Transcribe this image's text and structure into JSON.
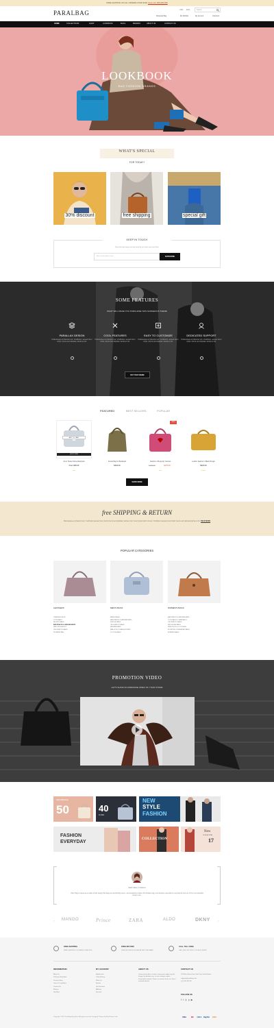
{
  "topbar": {
    "text": "FREE SHIPPING ON ALL ORDERS OVER $100",
    "link": "CALL US: 555-555-555"
  },
  "header": {
    "logo": "PARALBAG",
    "currency": "USD",
    "lang": "ENG",
    "search_placeholder": "Search",
    "account_links": [
      "Shopping Bag",
      "My Wishlist",
      "My account",
      "Checkout"
    ]
  },
  "nav": {
    "items": [
      "HOME",
      "COLLECTIONS",
      "SHOP",
      "LOOKBOOK",
      "BLOG",
      "BRANDS",
      "ABOUT US",
      "CONTACT US"
    ]
  },
  "hero": {
    "title": "LOOKBOOK",
    "subtitle": "BAG FASHION BRANDS"
  },
  "whats_special": {
    "title": "WHAT'S SPECIAL",
    "subtitle": "FOR TODAY?",
    "promos": [
      "30% discount",
      "free shipping",
      "special gift"
    ]
  },
  "newsletter": {
    "title": "KEEP IN TOUCH",
    "text": "Subscribe right away and stay tuned for our latest news and offers",
    "placeholder": "Enter email address here",
    "button": "SUBSCRIBE"
  },
  "features": {
    "title": "SOME FEATURES",
    "subtitle": "WHAT WILL MAKE YOU PURCHASE THIS GORGEOUS THEME",
    "items": [
      {
        "title": "PARALLAX DESIGN",
        "text": "Pellentesque ac pharetra nunc. Vestibulum, aenean lorem turpis, viverra sed vulputate, lacinia et nisl."
      },
      {
        "title": "COOL FEATURES",
        "text": "Pellentesque ac pharetra nunc. Vestibulum, aenean lorem turpis, viverra sed vulputate, lacinia et nisl."
      },
      {
        "title": "EASY TO CUSTOMIZE",
        "text": "Pellentesque ac pharetra nunc. Vestibulum, aenean lorem turpis, viverra sed vulputate, lacinia et nisl."
      },
      {
        "title": "DEDICATED SUPPORT",
        "text": "Pellentesque ac pharetra nunc. Vestibulum, aenean lorem turpis, viverra sed vulputate, lacinia et nisl."
      }
    ],
    "button": "BUY THIS THEME"
  },
  "products": {
    "tabs": [
      "FEATURED",
      "BEST SELLERS",
      "POPULAR"
    ],
    "items": [
      {
        "name": "Amet Trinket Stripe Backpack",
        "price": "From $35.00",
        "old_price": "",
        "add_to_cart": "ADD TO CART",
        "quick": "QUICK VIEW"
      },
      {
        "name": "Suede Bag for Backpack",
        "price": "$342.00",
        "old_price": "",
        "add_to_cart": "",
        "quick": ""
      },
      {
        "name": "Satchel in Burgundy Canvas",
        "price": "$175.00",
        "old_price": "$190.00",
        "add_to_cart": "",
        "quick": "",
        "badge": "SALE"
      },
      {
        "name": "Leather Satchel in Black Bougin",
        "price": "$323.00",
        "old_price": "",
        "add_to_cart": "",
        "quick": ""
      }
    ],
    "button": "SHOW MORE"
  },
  "shipping_banner": {
    "title": "free SHIPPING & RETURN",
    "text": "Pellentesque ac pharetra nunc. Vestibulum aenean lorem turpis viverra sed vulputate, lacinia et nisl. Lorem ipsum dolor sit amet. Vestibulum aenean lorem turpis viverra sed vulputate lacinia et nisl.",
    "link": "READ MORE"
  },
  "popular_categories": {
    "title": "POPULAR CATEGORIES",
    "columns": [
      {
        "title": "LEATHERS",
        "items": [
          "TRENDING NOW",
          "TOTE BAGS",
          "BUCKET BAGS",
          "BACKPACKS & MESSENGERS",
          "MINI CROSSBODY",
          "CROSSBODY BAGS",
          "WOMENS BAG"
        ]
      },
      {
        "title": "MEN'S BAGS",
        "items": [
          "BRIEFCASES",
          "BACKPACKS & MESSENGERS",
          "DUFFLE BAGS",
          "CROSSBODY BAGS",
          "MESSENGERS",
          "WALLETS & CARDHOLDERS",
          "CLUTCH BAGS"
        ]
      },
      {
        "title": "WOMEN'S BAGS",
        "items": [
          "BACKPACKS & MESSENGERS",
          "TOTE BAGS & CARRYALLS",
          "CROSSBODY BAGS",
          "SHOULDER BAGS",
          "WRISTLETS & CLUTCHES",
          "SPORTING & WEEKEND BAGS",
          "EVENING BAGS"
        ]
      }
    ]
  },
  "promotion_video": {
    "title": "PROMOTION VIDEO",
    "subtitle": "LET'S SHOW AN AWESOME VIDEO OF YOUR STORE"
  },
  "banners": {
    "b1_small": "NEW ARRIVALS",
    "b1_big": "50",
    "b2_big": "40",
    "b2_small": "% OFF",
    "b3_line1": "NEW",
    "b3_line2": "STYLE",
    "b3_line3": "FASHION",
    "b4_line1": "FASHION",
    "b4_line2": "EVERYDAY",
    "b5": "COLLECTION",
    "b6_line1": "New",
    "b6_line2": "COLLECTION",
    "b6_line3": "17"
  },
  "testimonial": {
    "name": "Sarah Jakes | Customer",
    "text": "Often Bag's unique-as-a-matter-of-fact design that bags are wonderfully-tuned - and exquisitely crafted. My Parallax bag is an absolute essential for everyday life and one of the most beautiful things I own."
  },
  "brands": [
    "MANGO",
    "Prince",
    "ZARA",
    "ALDO",
    "DKNY"
  ],
  "footer": {
    "services": [
      {
        "title": "FREE SHIPPING",
        "text": "FREE SHIPPING ON ORDER OVER $100"
      },
      {
        "title": "FREE RETURN",
        "text": "FREE RETURN IN 30 DAY AFTER PURCHASE"
      },
      {
        "title": "CALL TOLL FREE",
        "text": "CALL (847) 555 7659 TO PLACE ORDER"
      }
    ],
    "columns": [
      {
        "title": "INFORMATION",
        "items": [
          "About Us",
          "Delivery Information",
          "Privacy Policy",
          "Terms & Conditions",
          "Contact Us",
          "Returns",
          "Site Map"
        ]
      },
      {
        "title": "MY ACCOUNT",
        "items": [
          "My Account",
          "Order History",
          "Wish List",
          "Brands",
          "Gift Vouchers",
          "Affiliates",
          "Specials"
        ]
      }
    ],
    "about": {
      "title": "ABOUT US",
      "text": "Lorem ipsum dolor sit amet, consectetur adipiscing elit. Integer vestibulum nunc et urna volutpat sagittis. Suspendisse potenti. Donec accumsan lectus nec lorem euismod lobortis."
    },
    "contact": {
      "title": "CONTACT US",
      "lines": [
        "123 Main Street, New York City, United States",
        "support@paralbag.com",
        "(+1) 555 555 55"
      ],
      "follow": "FOLLOW US"
    },
    "copyright": "Copyright ©2017 Paralbag Bag Store. All rights reserved. Designed Themes by BonThemes.com",
    "payments": [
      "VISA",
      "MC",
      "AMEX",
      "PayPal",
      "DISC"
    ]
  },
  "colors": {
    "accent": "#111111",
    "hero_bg": "#eba8a6",
    "cream": "#f3e7cf",
    "sale": "#e74c3c"
  }
}
